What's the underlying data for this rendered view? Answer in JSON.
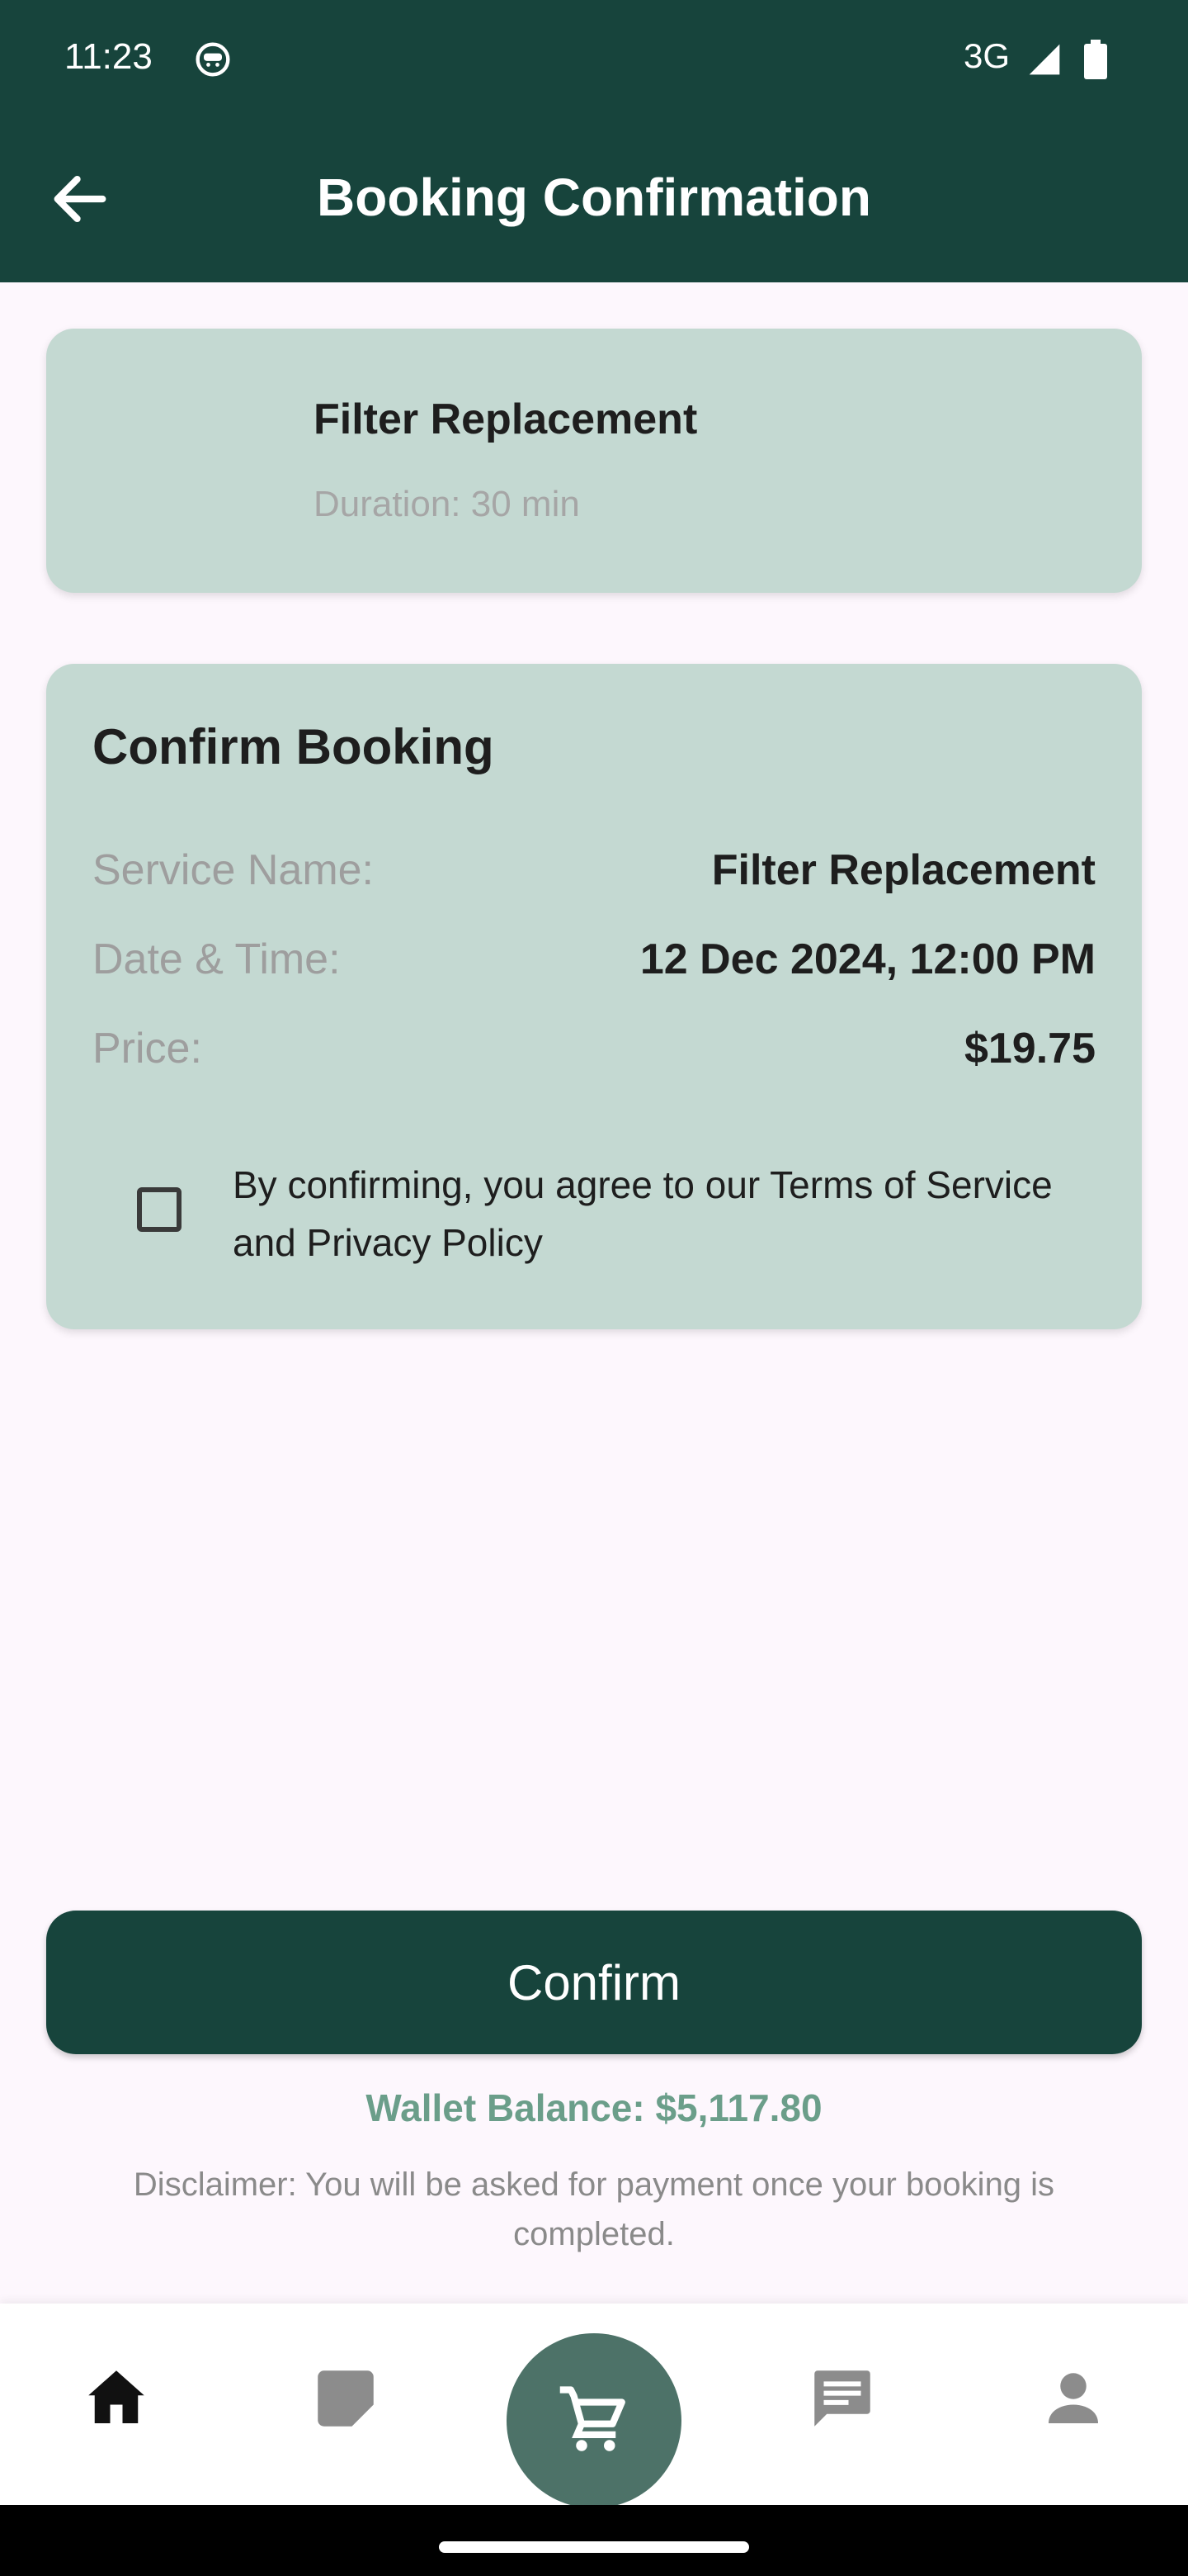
{
  "status_bar": {
    "time": "11:23",
    "network": "3G"
  },
  "app_bar": {
    "title": "Booking Confirmation"
  },
  "service_card": {
    "title": "Filter Replacement",
    "duration": "Duration: 30 min"
  },
  "confirm_card": {
    "title": "Confirm Booking",
    "rows": [
      {
        "label": "Service Name:",
        "value": "Filter Replacement"
      },
      {
        "label": "Date & Time:",
        "value": "12 Dec 2024, 12:00 PM"
      },
      {
        "label": "Price:",
        "value": "$19.75"
      }
    ],
    "terms_text": "By confirming, you agree to our Terms of Service and Privacy Policy",
    "terms_checked": false
  },
  "confirm_button": {
    "label": "Confirm"
  },
  "wallet_balance": "Wallet Balance: $5,117.80",
  "disclaimer": "Disclaimer: You will be asked for payment once your booking is completed.",
  "bottom_nav": {
    "items": [
      {
        "icon": "home-icon",
        "active": true
      },
      {
        "icon": "orders-icon",
        "active": false
      },
      {
        "icon": "cart-icon",
        "active": false
      },
      {
        "icon": "chat-icon",
        "active": false
      },
      {
        "icon": "profile-icon",
        "active": false
      }
    ]
  },
  "colors": {
    "primary": "#17443C",
    "card": "#C4D9D2",
    "background": "#FDF7FD",
    "wallet_text": "#6B9E8A",
    "fab": "#4D7268"
  }
}
